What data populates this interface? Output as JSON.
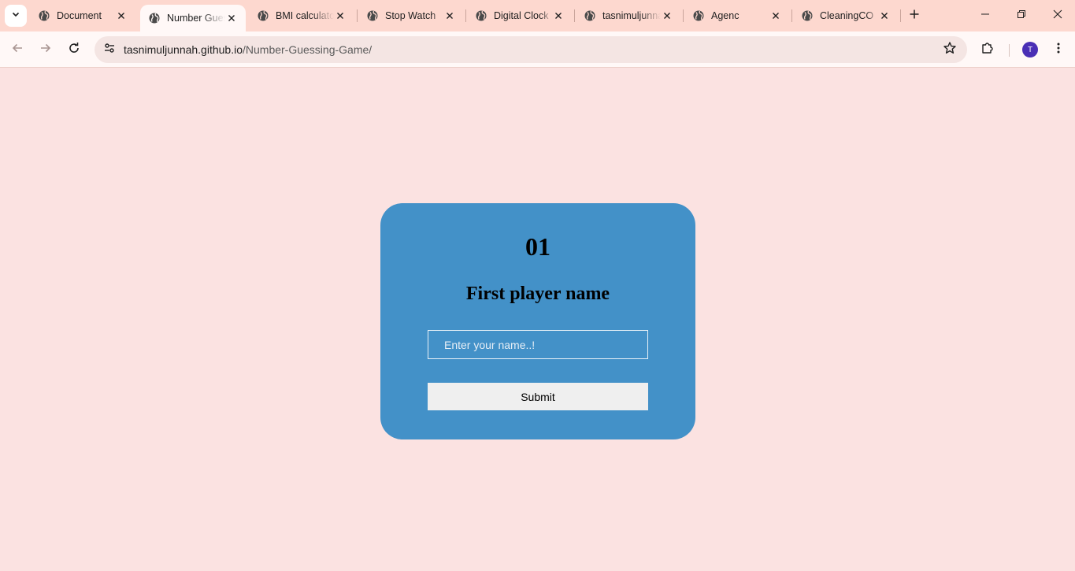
{
  "browser": {
    "tabs": [
      {
        "title": "Document",
        "active": false
      },
      {
        "title": "Number Guessing Game",
        "active": true
      },
      {
        "title": "BMI calculator",
        "active": false
      },
      {
        "title": "Stop Watch",
        "active": false
      },
      {
        "title": "Digital Clock",
        "active": false
      },
      {
        "title": "tasnimuljunnah",
        "active": false
      },
      {
        "title": "Agenc",
        "active": false
      },
      {
        "title": "CleaningCO",
        "active": false
      }
    ],
    "url_host": "tasnimuljunnah.github.io",
    "url_path": "/Number-Guessing-Game/",
    "profile_initial": "T",
    "accent_color": "#4a2fb5"
  },
  "page": {
    "background_color": "#fbe2e1",
    "card_color": "#4391c8",
    "player_number": "01",
    "player_label": "First player name",
    "name_input": {
      "value": "",
      "placeholder": "Enter your name..!"
    },
    "submit_label": "Submit"
  }
}
